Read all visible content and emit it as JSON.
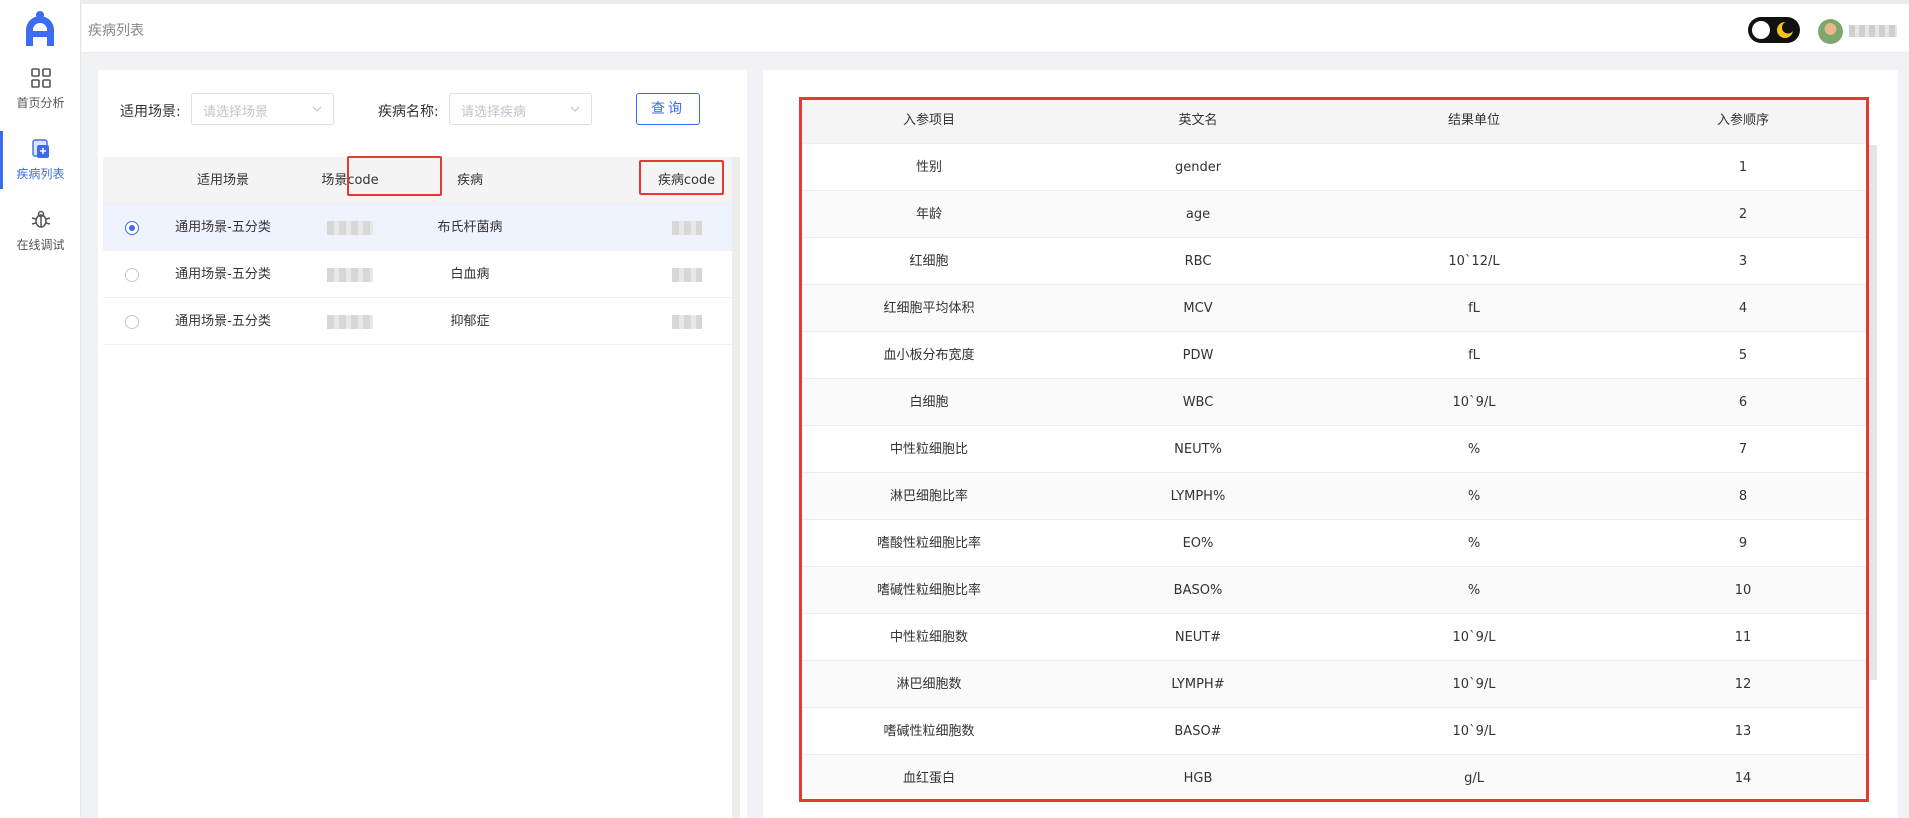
{
  "sidebar": {
    "items": [
      {
        "label": "首页分析"
      },
      {
        "label": "疾病列表"
      },
      {
        "label": "在线调试"
      }
    ]
  },
  "header": {
    "title": "疾病列表"
  },
  "filters": {
    "scene_label": "适用场景:",
    "scene_placeholder": "请选择场景",
    "disease_label": "疾病名称:",
    "disease_placeholder": "请选择疾病",
    "query_label": "查询"
  },
  "disease_table": {
    "columns": [
      "适用场景",
      "场景code",
      "疾病",
      "疾病code"
    ],
    "rows": [
      {
        "scene": "通用场景-五分类",
        "disease": "布氏杆菌病",
        "selected": true
      },
      {
        "scene": "通用场景-五分类",
        "disease": "白血病",
        "selected": false
      },
      {
        "scene": "通用场景-五分类",
        "disease": "抑郁症",
        "selected": false
      }
    ]
  },
  "param_table": {
    "columns": [
      "入参项目",
      "英文名",
      "结果单位",
      "入参顺序"
    ],
    "rows": [
      {
        "item": "性别",
        "en": "gender",
        "unit": "",
        "order": "1"
      },
      {
        "item": "年龄",
        "en": "age",
        "unit": "",
        "order": "2"
      },
      {
        "item": "红细胞",
        "en": "RBC",
        "unit": "10`12/L",
        "order": "3"
      },
      {
        "item": "红细胞平均体积",
        "en": "MCV",
        "unit": "fL",
        "order": "4"
      },
      {
        "item": "血小板分布宽度",
        "en": "PDW",
        "unit": "fL",
        "order": "5"
      },
      {
        "item": "白细胞",
        "en": "WBC",
        "unit": "10`9/L",
        "order": "6"
      },
      {
        "item": "中性粒细胞比",
        "en": "NEUT%",
        "unit": "%",
        "order": "7"
      },
      {
        "item": "淋巴细胞比率",
        "en": "LYMPH%",
        "unit": "%",
        "order": "8"
      },
      {
        "item": "嗜酸性粒细胞比率",
        "en": "EO%",
        "unit": "%",
        "order": "9"
      },
      {
        "item": "嗜碱性粒细胞比率",
        "en": "BASO%",
        "unit": "%",
        "order": "10"
      },
      {
        "item": "中性粒细胞数",
        "en": "NEUT#",
        "unit": "10`9/L",
        "order": "11"
      },
      {
        "item": "淋巴细胞数",
        "en": "LYMPH#",
        "unit": "10`9/L",
        "order": "12"
      },
      {
        "item": "嗜碱性粒细胞数",
        "en": "BASO#",
        "unit": "10`9/L",
        "order": "13"
      },
      {
        "item": "血红蛋白",
        "en": "HGB",
        "unit": "g/L",
        "order": "14"
      }
    ]
  },
  "colors": {
    "accent": "#3c6cf0",
    "highlight": "#e53935"
  },
  "icons": [
    "logo-icon",
    "dashboard-grid-icon",
    "disease-list-icon",
    "debug-bug-icon",
    "moon-icon",
    "chevron-down-icon"
  ]
}
